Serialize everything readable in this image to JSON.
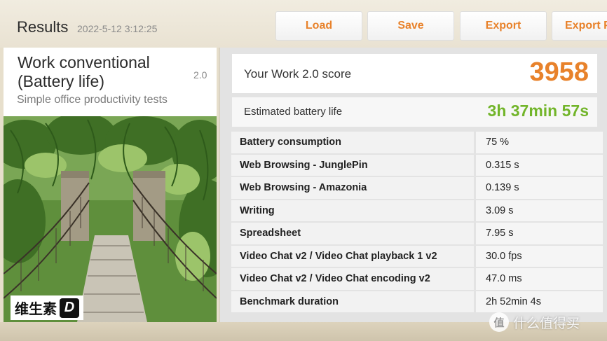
{
  "header": {
    "title": "Results",
    "date": "2022-5-12 3:12:25",
    "buttons": {
      "load": "Load",
      "save": "Save",
      "export": "Export",
      "export_partial": "Export P"
    }
  },
  "test": {
    "name": "Work conventional (Battery life)",
    "version": "2.0",
    "description": "Simple office productivity tests"
  },
  "score": {
    "label": "Your Work 2.0 score",
    "value": "3958"
  },
  "battery": {
    "label": "Estimated battery life",
    "value": "3h 37min 57s"
  },
  "metrics": [
    {
      "name": "Battery consumption",
      "value": "75 %"
    },
    {
      "name": "Web Browsing - JunglePin",
      "value": "0.315 s"
    },
    {
      "name": "Web Browsing - Amazonia",
      "value": "0.139 s"
    },
    {
      "name": "Writing",
      "value": "3.09 s"
    },
    {
      "name": "Spreadsheet",
      "value": "7.95 s"
    },
    {
      "name": "Video Chat v2 / Video Chat playback 1 v2",
      "value": "30.0 fps"
    },
    {
      "name": "Video Chat v2 / Video Chat encoding v2",
      "value": "47.0 ms"
    },
    {
      "name": "Benchmark duration",
      "value": "2h 52min 4s"
    }
  ],
  "watermarks": {
    "logo_text": "维生素",
    "logo_mark": "D",
    "site_icon": "值",
    "site_text": "什么值得买"
  },
  "colors": {
    "accent_orange": "#e8822b",
    "battery_green": "#72b52a"
  }
}
